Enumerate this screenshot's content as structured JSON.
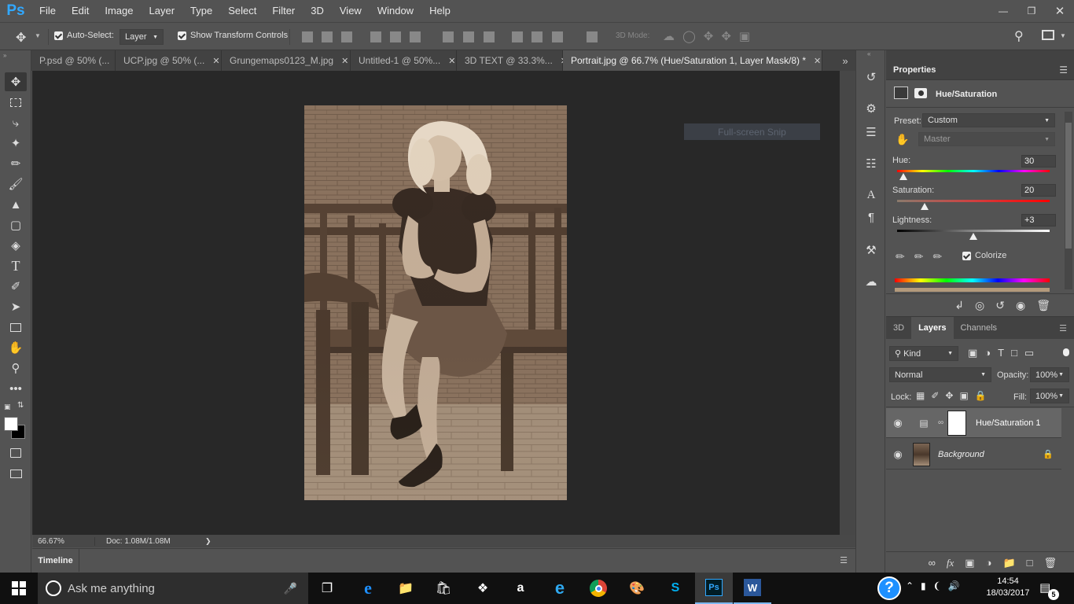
{
  "app": {
    "logo": "Ps"
  },
  "menu": [
    "File",
    "Edit",
    "Image",
    "Layer",
    "Type",
    "Select",
    "Filter",
    "3D",
    "View",
    "Window",
    "Help"
  ],
  "options": {
    "auto_select_label": "Auto-Select:",
    "auto_select_value": "Layer",
    "show_transform_label": "Show Transform Controls",
    "mode_3d_label": "3D Mode:"
  },
  "tabs": [
    {
      "label": "P.psd @ 50% (...",
      "close": "✕"
    },
    {
      "label": "UCP.jpg @ 50% (...",
      "close": "✕"
    },
    {
      "label": "Grungemaps0123_M.jpg",
      "close": "✕"
    },
    {
      "label": "Untitled-1 @ 50%...",
      "close": "✕"
    },
    {
      "label": "3D TEXT @ 33.3%...",
      "close": "✕"
    },
    {
      "label": "Portrait.jpg @ 66.7% (Hue/Saturation 1, Layer Mask/8) *",
      "close": "✕"
    }
  ],
  "overlay": {
    "snip_text": "Full-screen Snip"
  },
  "status": {
    "zoom": "66.67%",
    "doc": "Doc: 1.08M/1.08M",
    "arrow": "❯"
  },
  "timeline": {
    "label": "Timeline"
  },
  "properties": {
    "title": "Properties",
    "adjustment": "Hue/Saturation",
    "preset_label": "Preset:",
    "preset_value": "Custom",
    "channel_value": "Master",
    "hue_label": "Hue:",
    "hue_value": "30",
    "hue_level": 0.04,
    "saturation_label": "Saturation:",
    "saturation_value": "20",
    "saturation_level": 0.18,
    "lightness_label": "Lightness:",
    "lightness_value": "+3",
    "lightness_level": 0.5,
    "colorize_label": "Colorize",
    "colorize_checked": true
  },
  "layers_panel": {
    "tabs": [
      "3D",
      "Layers",
      "Channels"
    ],
    "active_tab": "Layers",
    "filter_label": "Kind",
    "blend_mode": "Normal",
    "opacity_label": "Opacity:",
    "opacity_value": "100%",
    "lock_label": "Lock:",
    "fill_label": "Fill:",
    "fill_value": "100%",
    "layers": [
      {
        "name": "Hue/Saturation 1",
        "selected": true
      },
      {
        "name": "Background",
        "locked": true
      }
    ]
  },
  "taskbar": {
    "search_placeholder": "Ask me anything",
    "time": "14:54",
    "date": "18/03/2017",
    "notifications": "5"
  },
  "colors": {
    "ps_blue": "#31a8ff",
    "panel_bg": "#535353",
    "canvas_bg": "#282828",
    "sepia": "#b39a7c"
  }
}
